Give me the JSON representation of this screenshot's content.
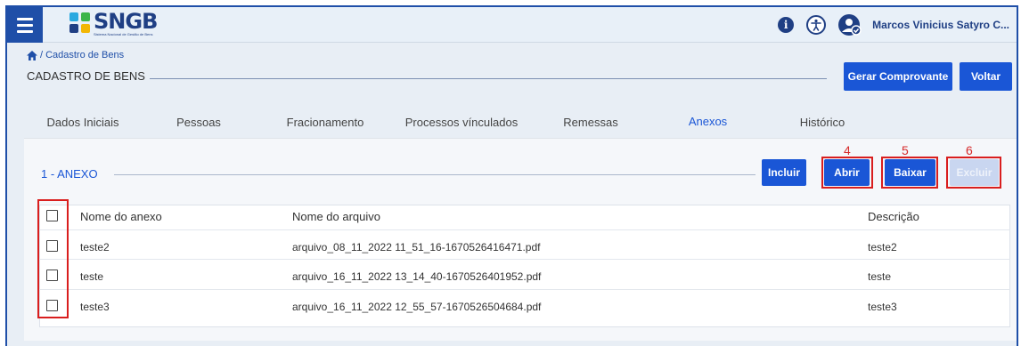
{
  "header": {
    "logo_text": "SNGB",
    "logo_subtitle": "Sistema Nacional de Gestão de Bens",
    "user_name": "Marcos Vinicius Satyro C...",
    "info_icon": "info-icon",
    "accessibility_icon": "accessibility-icon",
    "user_icon": "user-icon"
  },
  "breadcrumb": {
    "home_icon": "home-icon",
    "separator": "/",
    "current": "Cadastro de Bens"
  },
  "page": {
    "title": "CADASTRO DE BENS"
  },
  "actions": {
    "gerar_comprovante": "Gerar Comprovante",
    "voltar": "Voltar"
  },
  "tabs": [
    {
      "label": "Dados Iniciais",
      "active": false
    },
    {
      "label": "Pessoas",
      "active": false
    },
    {
      "label": "Fracionamento",
      "active": false
    },
    {
      "label": "Processos vínculados",
      "active": false
    },
    {
      "label": "Remessas",
      "active": false
    },
    {
      "label": "Anexos",
      "active": true
    },
    {
      "label": "Histórico",
      "active": false
    }
  ],
  "section": {
    "title": "1 - ANEXO",
    "buttons": {
      "incluir": "Incluir",
      "abrir": "Abrir",
      "baixar": "Baixar",
      "excluir": "Excluir"
    },
    "annotations": {
      "abrir": "4",
      "baixar": "5",
      "excluir": "6"
    }
  },
  "table": {
    "columns": {
      "nome_anexo": "Nome do anexo",
      "nome_arquivo": "Nome do arquivo",
      "descricao": "Descrição"
    },
    "rows": [
      {
        "nome_anexo": "teste2",
        "nome_arquivo": "arquivo_08_11_2022 11_51_16-1670526416471.pdf",
        "descricao": "teste2"
      },
      {
        "nome_anexo": "teste",
        "nome_arquivo": "arquivo_16_11_2022 13_14_40-1670526401952.pdf",
        "descricao": "teste"
      },
      {
        "nome_anexo": "teste3",
        "nome_arquivo": "arquivo_16_11_2022 12_55_57-1670526504684.pdf",
        "descricao": "teste3"
      }
    ]
  },
  "colors": {
    "primary": "#1a56d6",
    "brand": "#1f3f84",
    "annotation": "#d91e1e"
  }
}
